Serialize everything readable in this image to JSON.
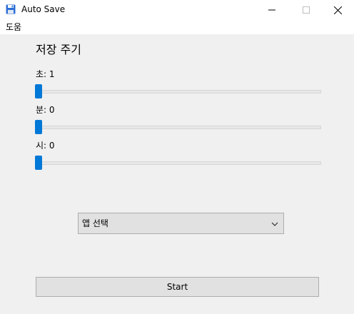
{
  "window": {
    "title": "Auto Save",
    "icon": "floppy-disk-icon",
    "controls": [
      "minimize-icon",
      "maximize-icon",
      "close-icon"
    ]
  },
  "menu": {
    "help_label": "도움"
  },
  "main": {
    "section_title": "저장 주기",
    "sliders": [
      {
        "label": "초: 1",
        "value": 1
      },
      {
        "label": "분: 0",
        "value": 0
      },
      {
        "label": "시: 0",
        "value": 0
      }
    ],
    "app_select": {
      "selected": "앱 선택"
    },
    "start_label": "Start"
  },
  "colors": {
    "accent": "#0078d7",
    "background": "#f0f0f0",
    "button_bg": "#e1e1e1"
  }
}
